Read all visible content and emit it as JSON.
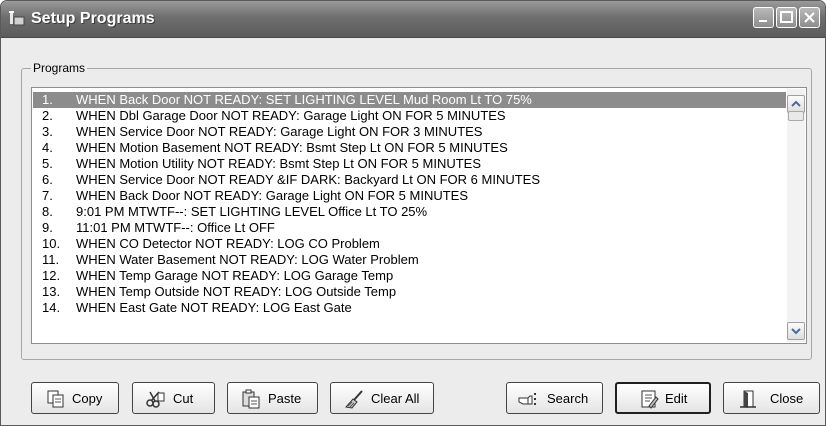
{
  "window": {
    "title": "Setup Programs"
  },
  "group": {
    "label": "Programs"
  },
  "programs": [
    {
      "num": "1.",
      "text": "WHEN Back Door NOT READY: SET LIGHTING LEVEL Mud Room Lt TO 75%",
      "selected": true
    },
    {
      "num": "2.",
      "text": "WHEN Dbl Garage Door NOT READY: Garage Light ON FOR 5 MINUTES"
    },
    {
      "num": "3.",
      "text": "WHEN Service Door NOT READY: Garage Light ON FOR 3 MINUTES"
    },
    {
      "num": "4.",
      "text": "WHEN Motion Basement NOT READY: Bsmt Step Lt ON FOR 5 MINUTES"
    },
    {
      "num": "5.",
      "text": "WHEN Motion Utility NOT READY: Bsmt Step Lt ON FOR 5 MINUTES"
    },
    {
      "num": "6.",
      "text": "WHEN Service Door NOT READY &IF DARK: Backyard Lt ON FOR 6 MINUTES"
    },
    {
      "num": "7.",
      "text": "WHEN Back Door NOT READY: Garage Light ON FOR 5 MINUTES"
    },
    {
      "num": "8.",
      "text": "9:01 PM MTWTF--: SET LIGHTING LEVEL Office Lt TO 25%"
    },
    {
      "num": "9.",
      "text": "11:01 PM MTWTF--: Office Lt OFF"
    },
    {
      "num": "10.",
      "text": "WHEN CO Detector NOT READY: LOG CO Problem"
    },
    {
      "num": "11.",
      "text": "WHEN Water Basement NOT READY: LOG Water Problem"
    },
    {
      "num": "12.",
      "text": "WHEN Temp Garage NOT READY: LOG Garage Temp"
    },
    {
      "num": "13.",
      "text": "WHEN Temp Outside NOT READY: LOG Outside Temp"
    },
    {
      "num": "14.",
      "text": "WHEN East Gate NOT READY: LOG East Gate"
    }
  ],
  "buttons": {
    "copy": {
      "label": "Copy",
      "icon": "copy-icon"
    },
    "cut": {
      "label": "Cut",
      "icon": "scissors-icon"
    },
    "paste": {
      "label": "Paste",
      "icon": "paste-icon"
    },
    "clear_all": {
      "label": "Clear All",
      "icon": "broom-icon"
    },
    "search": {
      "label": "Search",
      "icon": "pointing-hand-icon"
    },
    "edit": {
      "label": "Edit",
      "icon": "edit-document-icon"
    },
    "close": {
      "label": "Close",
      "icon": "door-icon"
    }
  },
  "colors": {
    "selection": "#8c8c8c",
    "titlebar": "#6e6e6e"
  }
}
